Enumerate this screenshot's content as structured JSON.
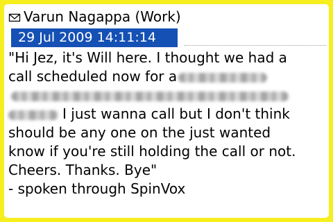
{
  "header": {
    "envelope_icon": "envelope-icon",
    "sender": "Varun Nagappa (Work)"
  },
  "meta": {
    "datetime": "29 Jul 2009 14:11:14"
  },
  "message": {
    "line1": "\"Hi Jez, it's Will here. I thought we had a",
    "line2": "call scheduled now for a",
    "line3": "",
    "line4": "I just wanna call but I don't think",
    "line5": "should be any one on the just wanted",
    "line6": "know if you're still holding the call or not.",
    "line7": "Cheers. Thanks. Bye\"",
    "line8": "- spoken through SpinVox"
  },
  "colors": {
    "frame": "#f6ee1f",
    "highlight": "#1550b4"
  }
}
